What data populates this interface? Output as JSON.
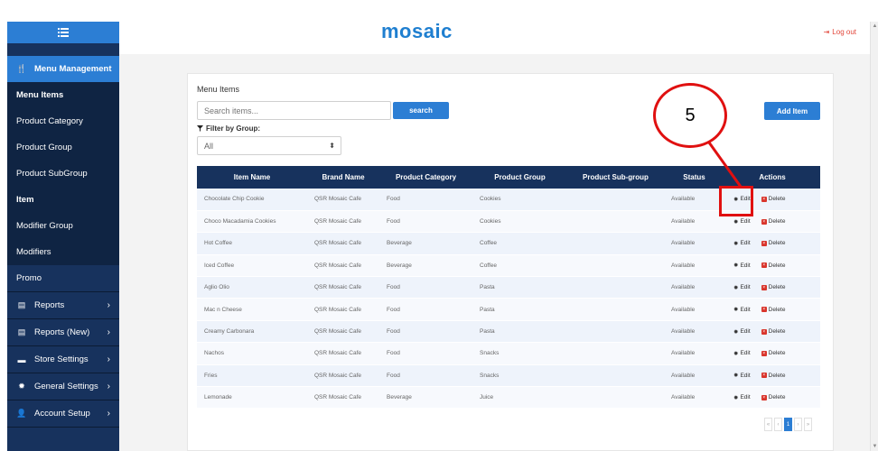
{
  "header": {
    "logo_text": "mosaic",
    "logout_label": "Log out"
  },
  "sidebar": {
    "toggle_icon": "menu-list-icon",
    "items": [
      {
        "label": "Menu Management",
        "icon": "fork-knife-icon",
        "state": "active"
      },
      {
        "label": "Menu Items",
        "state": "bold"
      },
      {
        "label": "Product Category",
        "state": "sub"
      },
      {
        "label": "Product Group",
        "state": "sub"
      },
      {
        "label": "Product SubGroup",
        "state": "sub"
      },
      {
        "label": "Item",
        "state": "sub-current"
      },
      {
        "label": "Modifier Group",
        "state": "sub"
      },
      {
        "label": "Modifiers",
        "state": "sub"
      },
      {
        "label": "Promo",
        "state": "plain"
      },
      {
        "label": "Reports",
        "icon": "report-icon",
        "chevron": true
      },
      {
        "label": "Reports (New)",
        "icon": "report-icon",
        "chevron": true
      },
      {
        "label": "Store Settings",
        "icon": "store-icon",
        "chevron": true
      },
      {
        "label": "General Settings",
        "icon": "gear-icon",
        "chevron": true
      },
      {
        "label": "Account Setup",
        "icon": "user-icon",
        "chevron": true
      }
    ]
  },
  "main": {
    "title": "Menu Items",
    "search_placeholder": "Search items...",
    "search_button": "search",
    "add_button": "Add Item",
    "filter_label": "Filter by Group:",
    "filter_value": "All",
    "columns": [
      "Item Name",
      "Brand Name",
      "Product Category",
      "Product Group",
      "Product Sub-group",
      "Status",
      "Actions"
    ],
    "rows": [
      [
        "Chocolate Chip Cookie",
        "QSR Mosaic Cafe",
        "Food",
        "Cookies",
        "",
        "Available"
      ],
      [
        "Choco Macadamia Cookies",
        "QSR Mosaic Cafe",
        "Food",
        "Cookies",
        "",
        "Available"
      ],
      [
        "Hot Coffee",
        "QSR Mosaic Cafe",
        "Beverage",
        "Coffee",
        "",
        "Available"
      ],
      [
        "Iced Coffee",
        "QSR Mosaic Cafe",
        "Beverage",
        "Coffee",
        "",
        "Available"
      ],
      [
        "Aglio Olio",
        "QSR Mosaic Cafe",
        "Food",
        "Pasta",
        "",
        "Available"
      ],
      [
        "Mac n Cheese",
        "QSR Mosaic Cafe",
        "Food",
        "Pasta",
        "",
        "Available"
      ],
      [
        "Creamy Carbonara",
        "QSR Mosaic Cafe",
        "Food",
        "Pasta",
        "",
        "Available"
      ],
      [
        "Nachos",
        "QSR Mosaic Cafe",
        "Food",
        "Snacks",
        "",
        "Available"
      ],
      [
        "Fries",
        "QSR Mosaic Cafe",
        "Food",
        "Snacks",
        "",
        "Available"
      ],
      [
        "Lemonade",
        "QSR Mosaic Cafe",
        "Beverage",
        "Juice",
        "",
        "Available"
      ]
    ],
    "edit_label": "Edit",
    "delete_label": "Delete",
    "pagination": [
      "«",
      "‹",
      "1",
      "›",
      "»"
    ],
    "current_page": "1"
  },
  "annotation": {
    "callout_number": "5"
  },
  "colors": {
    "sidebar_bg": "#17325d",
    "accent": "#2c7ed4",
    "danger": "#d9342b",
    "callout": "#e01010"
  }
}
